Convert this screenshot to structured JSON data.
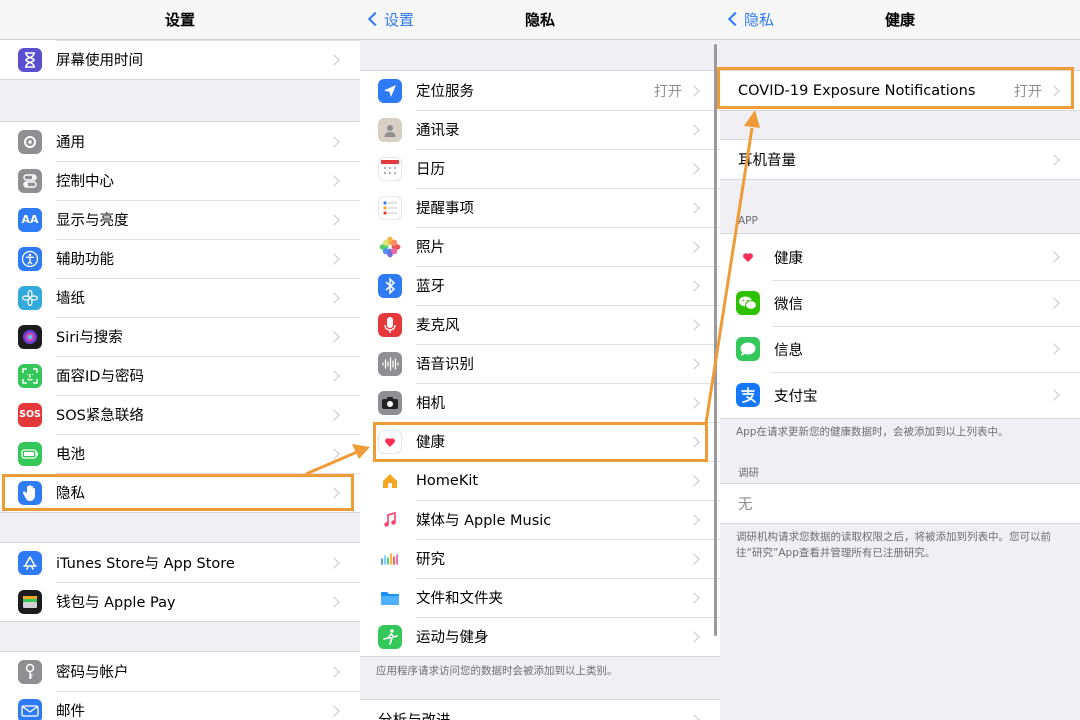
{
  "colors": {
    "accent": "#2f7bf6",
    "highlight": "#ef9b38",
    "background": "#efeff4"
  },
  "settings": {
    "title": "设置",
    "group0": [
      {
        "label": "屏幕使用时间",
        "icon": "hourglass-icon",
        "color": "#5a4fcf"
      }
    ],
    "group1": [
      {
        "label": "通用",
        "icon": "gear-icon",
        "color": "#8e8e93"
      },
      {
        "label": "控制中心",
        "icon": "toggles-icon",
        "color": "#8e8e93"
      },
      {
        "label": "显示与亮度",
        "icon": "text-size-icon",
        "color": "#2f7bf6"
      },
      {
        "label": "辅助功能",
        "icon": "accessibility-icon",
        "color": "#2f7bf6"
      },
      {
        "label": "墙纸",
        "icon": "flower-icon",
        "color": "#34aadc"
      },
      {
        "label": "Siri与搜索",
        "icon": "siri-icon",
        "color": "#222"
      },
      {
        "label": "面容ID与密码",
        "icon": "face-id-icon",
        "color": "#34c759"
      },
      {
        "label": "SOS紧急联络",
        "icon": "sos-icon",
        "color": "#e5383b",
        "icon_text": "SOS"
      },
      {
        "label": "电池",
        "icon": "battery-icon",
        "color": "#34c759"
      },
      {
        "label": "隐私",
        "icon": "hand-icon",
        "color": "#2f7bf6"
      }
    ],
    "group2": [
      {
        "label": "iTunes Store与 App Store",
        "icon": "app-store-icon",
        "color": "#2f7bf6"
      },
      {
        "label": "钱包与 Apple Pay",
        "icon": "wallet-icon",
        "color": "#222"
      }
    ],
    "group3": [
      {
        "label": "密码与帐户",
        "icon": "key-icon",
        "color": "#8e8e93"
      },
      {
        "label": "邮件",
        "icon": "mail-icon",
        "color": "#2f7bf6"
      }
    ]
  },
  "privacy": {
    "title": "隐私",
    "back_label": "设置",
    "items": [
      {
        "label": "定位服务",
        "value": "打开",
        "icon": "location-arrow-icon",
        "color": "#2f7bf6"
      },
      {
        "label": "通讯录",
        "icon": "contacts-icon",
        "color": "#c7c2b6"
      },
      {
        "label": "日历",
        "icon": "calendar-icon",
        "color": "#ffffff"
      },
      {
        "label": "提醒事项",
        "icon": "reminders-icon",
        "color": "#ffffff"
      },
      {
        "label": "照片",
        "icon": "photos-icon",
        "color": "#ffffff"
      },
      {
        "label": "蓝牙",
        "icon": "bluetooth-icon",
        "color": "#2f7bf6"
      },
      {
        "label": "麦克风",
        "icon": "microphone-icon",
        "color": "#e5383b"
      },
      {
        "label": "语音识别",
        "icon": "waveform-icon",
        "color": "#8e8e93"
      },
      {
        "label": "相机",
        "icon": "camera-icon",
        "color": "#8e8e93"
      },
      {
        "label": "健康",
        "icon": "heart-icon",
        "color": "#ffffff"
      },
      {
        "label": "HomeKit",
        "icon": "home-icon",
        "color": "#ffffff"
      },
      {
        "label": "媒体与 Apple Music",
        "icon": "music-note-icon",
        "color": "#ffffff"
      },
      {
        "label": "研究",
        "icon": "research-icon",
        "color": "#ffffff"
      },
      {
        "label": "文件和文件夹",
        "icon": "folder-icon",
        "color": "#ffffff"
      },
      {
        "label": "运动与健身",
        "icon": "fitness-icon",
        "color": "#34c759"
      }
    ],
    "footer": "应用程序请求访问您的数据时会被添加到以上类别。",
    "next_label": "分析与改进"
  },
  "health": {
    "title": "健康",
    "back_label": "隐私",
    "covid_label": "COVID-19 Exposure Notifications",
    "covid_value": "打开",
    "headphone_label": "耳机音量",
    "app_header": "APP",
    "apps": [
      {
        "label": "健康",
        "icon": "heart-icon",
        "color": "#ffffff"
      },
      {
        "label": "微信",
        "icon": "wechat-icon",
        "color": "#2dc100"
      },
      {
        "label": "信息",
        "icon": "messages-icon",
        "color": "#34c759"
      },
      {
        "label": "支付宝",
        "icon": "alipay-icon",
        "color": "#1677ff"
      }
    ],
    "app_footer": "App在请求更新您的健康数据时，会被添加到以上列表中。",
    "research_header": "调研",
    "research_none": "无",
    "research_footer": "调研机构请求您数据的读取权限之后，将被添加到列表中。您可以前往“研究”App查看并管理所有已注册研究。"
  }
}
